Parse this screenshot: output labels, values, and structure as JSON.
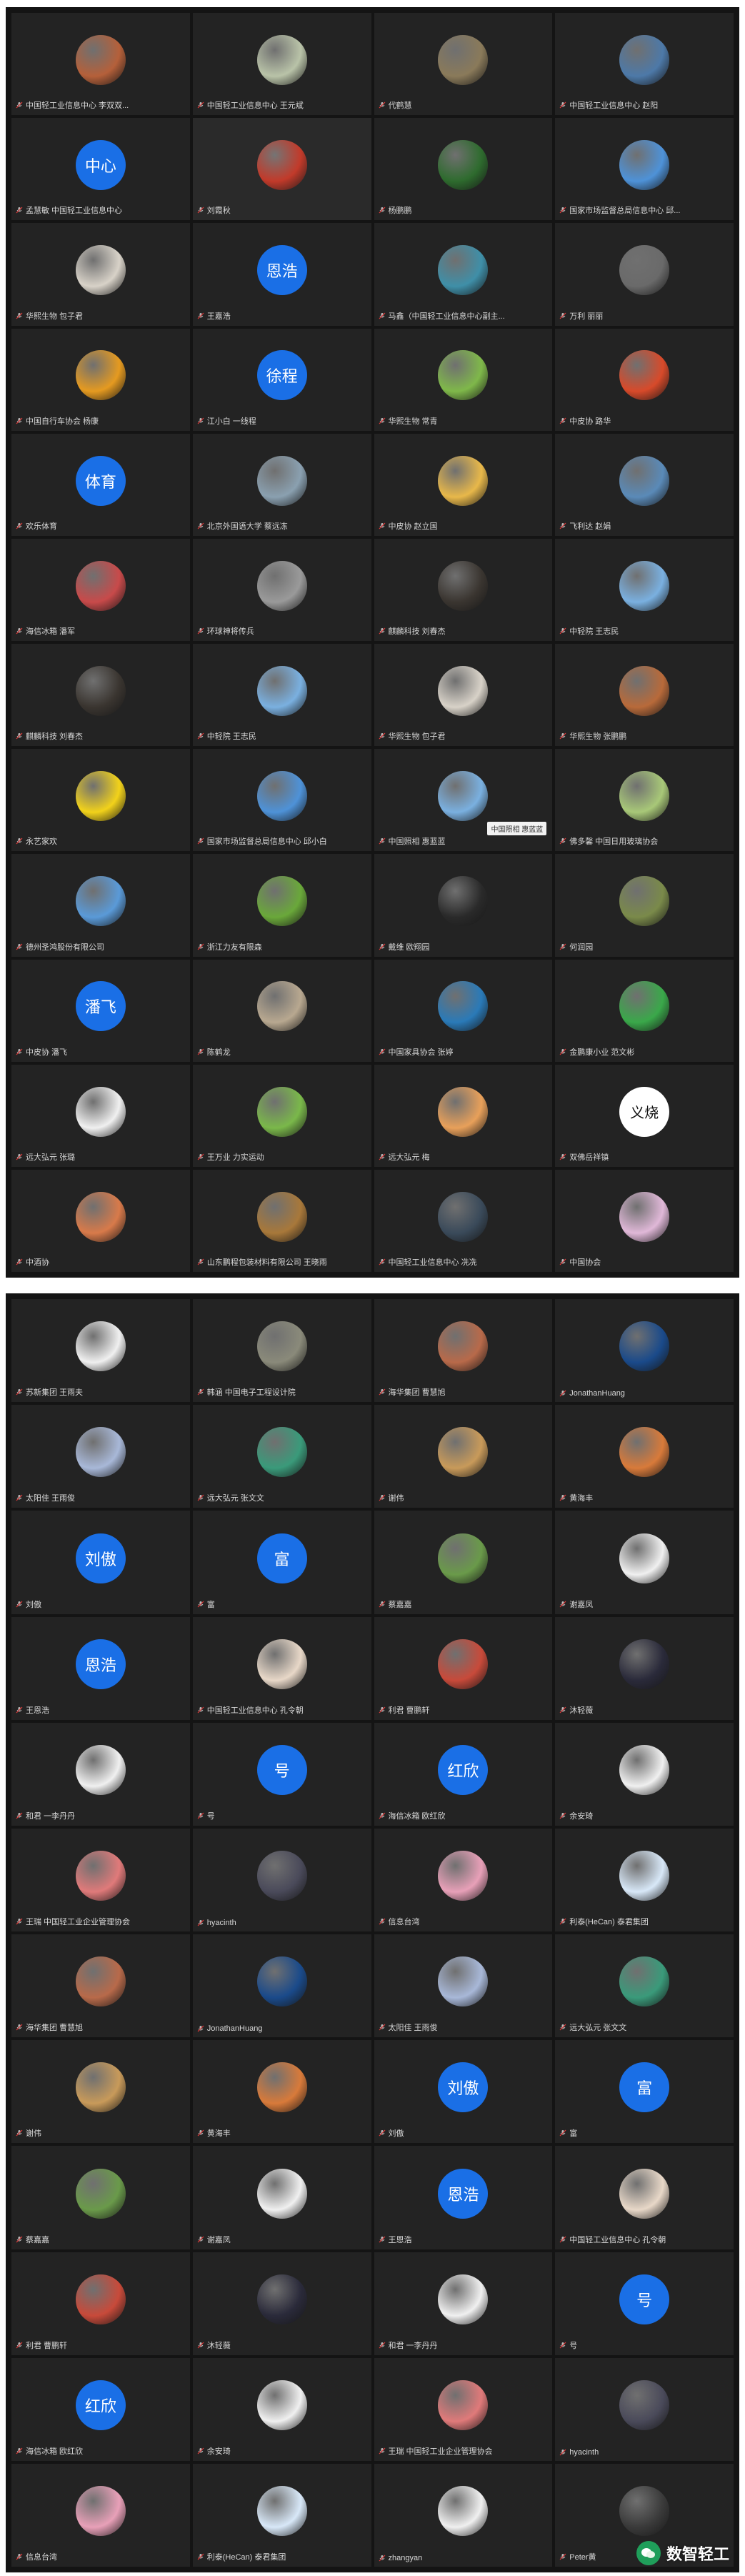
{
  "colors": {
    "tile_bg": "#232323",
    "text_avatar_bg": "#1a6fe6",
    "name_text": "#d8d8d8"
  },
  "screenshot1": {
    "participants": [
      {
        "name": "中国轻工业信息中心 李双双...",
        "avatar": {
          "kind": "photo",
          "color": "#b5603a"
        }
      },
      {
        "name": "中国轻工业信息中心 王元斌",
        "avatar": {
          "kind": "photo",
          "color": "#b9c3a8"
        }
      },
      {
        "name": "代鹤慧",
        "avatar": {
          "kind": "photo",
          "color": "#8a7a5a"
        }
      },
      {
        "name": "中国轻工业信息中心 赵阳",
        "avatar": {
          "kind": "photo",
          "color": "#4d79a8"
        }
      },
      {
        "name": "孟慧敏 中国轻工业信息中心",
        "avatar": {
          "kind": "text",
          "text": "中心"
        }
      },
      {
        "name": "刘霞秋",
        "avatar": {
          "kind": "photo",
          "color": "#c23a2a"
        },
        "highlight": true
      },
      {
        "name": "杨鹏鹏",
        "avatar": {
          "kind": "photo",
          "color": "#2e6b2e"
        }
      },
      {
        "name": "国家市场监督总局信息中心 邱...",
        "avatar": {
          "kind": "photo",
          "color": "#4e92d8"
        }
      },
      {
        "name": "华熙生物 包子君",
        "avatar": {
          "kind": "photo",
          "color": "#d8d2c8"
        }
      },
      {
        "name": "王嘉浩",
        "avatar": {
          "kind": "text",
          "text": "恩浩"
        }
      },
      {
        "name": "马鑫（中国轻工业信息中心副主...",
        "avatar": {
          "kind": "photo",
          "color": "#3f8fa8"
        }
      },
      {
        "name": "万利 丽丽",
        "avatar": {
          "kind": "photo",
          "color": "#6a6a6a"
        }
      },
      {
        "name": "中国自行车协会 杨康",
        "avatar": {
          "kind": "photo",
          "color": "#e59a20"
        }
      },
      {
        "name": "江小白 一线程",
        "avatar": {
          "kind": "text",
          "text": "徐程"
        }
      },
      {
        "name": "华熙生物 常青",
        "avatar": {
          "kind": "photo",
          "color": "#7fb84a"
        }
      },
      {
        "name": "中皮协 路华",
        "avatar": {
          "kind": "photo",
          "color": "#d84a2a"
        }
      },
      {
        "name": "欢乐体育",
        "avatar": {
          "kind": "text",
          "text": "体育"
        }
      },
      {
        "name": "北京外国语大学 蔡远冻",
        "avatar": {
          "kind": "photo",
          "color": "#8aa0b0"
        }
      },
      {
        "name": "中皮协 赵立国",
        "avatar": {
          "kind": "photo",
          "color": "#e8b84a"
        }
      },
      {
        "name": "飞利达 赵娟",
        "avatar": {
          "kind": "photo",
          "color": "#5a8ab8"
        }
      },
      {
        "name": "海信冰箱 潘军",
        "avatar": {
          "kind": "photo",
          "color": "#c84a4a"
        }
      },
      {
        "name": "环球神将传兵",
        "avatar": {
          "kind": "photo",
          "color": "#9a9a9a"
        }
      },
      {
        "name": "麒麟科技 刘春杰",
        "avatar": {
          "kind": "photo",
          "color": "#3a3530"
        }
      },
      {
        "name": "中轻院 王志民",
        "avatar": {
          "kind": "photo",
          "color": "#7ab0e0"
        }
      },
      {
        "name": "麒麟科技 刘春杰",
        "avatar": {
          "kind": "photo",
          "color": "#3a3530"
        }
      },
      {
        "name": "中轻院 王志民",
        "avatar": {
          "kind": "photo",
          "color": "#7ab0e0"
        }
      },
      {
        "name": "华熙生物 包子君",
        "avatar": {
          "kind": "photo",
          "color": "#d8d2c8"
        }
      },
      {
        "name": "华熙生物 张鹏鹏",
        "avatar": {
          "kind": "photo",
          "color": "#b86a3a"
        }
      },
      {
        "name": "永艺家欢",
        "avatar": {
          "kind": "photo",
          "color": "#f2d21a"
        }
      },
      {
        "name": "国家市场监督总局信息中心 邱小白",
        "avatar": {
          "kind": "photo",
          "color": "#4e92d8"
        }
      },
      {
        "name": "中国照相 惠蓝蓝",
        "avatar": {
          "kind": "photo",
          "color": "#7ab0e0"
        },
        "tooltip": "中国照相 惠蓝蓝"
      },
      {
        "name": "佛多馨 中国日用玻璃协会",
        "avatar": {
          "kind": "photo",
          "color": "#a8c878"
        }
      },
      {
        "name": "德州圣鸿股份有限公司",
        "avatar": {
          "kind": "photo",
          "color": "#5a9ad8"
        }
      },
      {
        "name": "浙江力友有限森",
        "avatar": {
          "kind": "photo",
          "color": "#6aa83a"
        }
      },
      {
        "name": "戴维 欧翔园",
        "avatar": {
          "kind": "photo",
          "color": "#2a2a2a"
        }
      },
      {
        "name": "何润园",
        "avatar": {
          "kind": "photo",
          "color": "#7a8a4a"
        }
      },
      {
        "name": "中皮协 潘飞",
        "avatar": {
          "kind": "text",
          "text": "潘飞"
        }
      },
      {
        "name": "陈鹤龙",
        "avatar": {
          "kind": "photo",
          "color": "#b8a890"
        }
      },
      {
        "name": "中国家具协会 张婷",
        "avatar": {
          "kind": "photo",
          "color": "#2a7ab8"
        }
      },
      {
        "name": "金鹏康小业 范文彬",
        "avatar": {
          "kind": "photo",
          "color": "#3aa84a"
        }
      },
      {
        "name": "远大弘元 张璐",
        "avatar": {
          "kind": "photo",
          "color": "#f0f0f0"
        }
      },
      {
        "name": "王万业 力实运动",
        "avatar": {
          "kind": "photo",
          "color": "#7ab84a"
        }
      },
      {
        "name": "远大弘元 梅",
        "avatar": {
          "kind": "photo",
          "color": "#e8a05a"
        }
      },
      {
        "name": "双佛岳祥镇",
        "avatar": {
          "kind": "white",
          "text": "义烧"
        }
      },
      {
        "name": "中酒协",
        "avatar": {
          "kind": "photo",
          "color": "#d87a4a"
        }
      },
      {
        "name": "山东鹏程包装材料有限公司 王晓雨",
        "avatar": {
          "kind": "photo",
          "color": "#a8783a"
        }
      },
      {
        "name": "中国轻工业信息中心 冼冼",
        "avatar": {
          "kind": "photo",
          "color": "#3a4a5a"
        }
      },
      {
        "name": "中国协会",
        "avatar": {
          "kind": "photo",
          "color": "#e0b8d8"
        }
      }
    ]
  },
  "screenshot2": {
    "participants": [
      {
        "name": "苏新集团 王雨夫",
        "avatar": {
          "kind": "photo",
          "color": "#f0f0f0"
        }
      },
      {
        "name": "韩涵 中国电子工程设计院",
        "avatar": {
          "kind": "photo",
          "color": "#8a8a7a"
        }
      },
      {
        "name": "海华集团 曹慧旭",
        "avatar": {
          "kind": "photo",
          "color": "#b86a4a"
        }
      },
      {
        "name": "JonathanHuang",
        "avatar": {
          "kind": "photo",
          "color": "#1a4a8a"
        }
      },
      {
        "name": "太阳佳 王雨俊",
        "avatar": {
          "kind": "photo",
          "color": "#a8b8d8"
        }
      },
      {
        "name": "远大弘元 张文文",
        "avatar": {
          "kind": "photo",
          "color": "#3a9a7a"
        }
      },
      {
        "name": "谢伟",
        "avatar": {
          "kind": "photo",
          "color": "#c89a5a"
        }
      },
      {
        "name": "黄海丰",
        "avatar": {
          "kind": "photo",
          "color": "#d87a3a"
        }
      },
      {
        "name": "刘傲",
        "avatar": {
          "kind": "text",
          "text": "刘傲"
        }
      },
      {
        "name": "富",
        "avatar": {
          "kind": "text",
          "text": "富"
        }
      },
      {
        "name": "蔡嘉嘉",
        "avatar": {
          "kind": "photo",
          "color": "#6a9a4a"
        }
      },
      {
        "name": "谢嘉凤",
        "avatar": {
          "kind": "photo",
          "color": "#f0f0f0"
        }
      },
      {
        "name": "王恩浩",
        "avatar": {
          "kind": "text",
          "text": "恩浩"
        }
      },
      {
        "name": "中国轻工业信息中心 孔令朝",
        "avatar": {
          "kind": "photo",
          "color": "#e8d8c8"
        }
      },
      {
        "name": "利君 曹鹏轩",
        "avatar": {
          "kind": "photo",
          "color": "#c84a3a"
        }
      },
      {
        "name": "沐轻薇",
        "avatar": {
          "kind": "photo",
          "color": "#2a2a3a"
        }
      },
      {
        "name": "和君 一李丹丹",
        "avatar": {
          "kind": "photo",
          "color": "#f0f0f0"
        }
      },
      {
        "name": "号",
        "avatar": {
          "kind": "text",
          "text": "号"
        }
      },
      {
        "name": "海信冰箱 欧红欣",
        "avatar": {
          "kind": "text",
          "text": "红欣"
        }
      },
      {
        "name": "余安琦",
        "avatar": {
          "kind": "photo",
          "color": "#f0f0f0"
        }
      },
      {
        "name": "王瑞 中国轻工业企业管理协会",
        "avatar": {
          "kind": "photo",
          "color": "#e07a7a"
        }
      },
      {
        "name": "hyacinth",
        "avatar": {
          "kind": "photo",
          "color": "#4a4a5a"
        }
      },
      {
        "name": "信息台湾",
        "avatar": {
          "kind": "photo",
          "color": "#e8a0b8"
        }
      },
      {
        "name": "利泰(HeCan) 泰君集团",
        "avatar": {
          "kind": "photo",
          "color": "#d8e8f8"
        }
      },
      {
        "name": "海华集团 曹慧旭",
        "avatar": {
          "kind": "photo",
          "color": "#b86a4a"
        }
      },
      {
        "name": "JonathanHuang",
        "avatar": {
          "kind": "photo",
          "color": "#1a4a8a"
        }
      },
      {
        "name": "太阳佳 王雨俊",
        "avatar": {
          "kind": "photo",
          "color": "#a8b8d8"
        }
      },
      {
        "name": "远大弘元 张文文",
        "avatar": {
          "kind": "photo",
          "color": "#3a9a7a"
        }
      },
      {
        "name": "谢伟",
        "avatar": {
          "kind": "photo",
          "color": "#c89a5a"
        }
      },
      {
        "name": "黄海丰",
        "avatar": {
          "kind": "photo",
          "color": "#d87a3a"
        }
      },
      {
        "name": "刘傲",
        "avatar": {
          "kind": "text",
          "text": "刘傲"
        }
      },
      {
        "name": "富",
        "avatar": {
          "kind": "text",
          "text": "富"
        }
      },
      {
        "name": "蔡嘉嘉",
        "avatar": {
          "kind": "photo",
          "color": "#6a9a4a"
        }
      },
      {
        "name": "谢嘉凤",
        "avatar": {
          "kind": "photo",
          "color": "#f0f0f0"
        }
      },
      {
        "name": "王恩浩",
        "avatar": {
          "kind": "text",
          "text": "恩浩"
        }
      },
      {
        "name": "中国轻工业信息中心 孔令朝",
        "avatar": {
          "kind": "photo",
          "color": "#e8d8c8"
        }
      },
      {
        "name": "利君 曹鹏轩",
        "avatar": {
          "kind": "photo",
          "color": "#c84a3a"
        }
      },
      {
        "name": "沐轻薇",
        "avatar": {
          "kind": "photo",
          "color": "#2a2a3a"
        }
      },
      {
        "name": "和君 一李丹丹",
        "avatar": {
          "kind": "photo",
          "color": "#f0f0f0"
        }
      },
      {
        "name": "号",
        "avatar": {
          "kind": "text",
          "text": "号"
        }
      },
      {
        "name": "海信冰箱 欧红欣",
        "avatar": {
          "kind": "text",
          "text": "红欣"
        }
      },
      {
        "name": "余安琦",
        "avatar": {
          "kind": "photo",
          "color": "#f0f0f0"
        }
      },
      {
        "name": "王瑞 中国轻工业企业管理协会",
        "avatar": {
          "kind": "photo",
          "color": "#e07a7a"
        }
      },
      {
        "name": "hyacinth",
        "avatar": {
          "kind": "photo",
          "color": "#4a4a5a"
        }
      },
      {
        "name": "信息台湾",
        "avatar": {
          "kind": "photo",
          "color": "#e8a0b8"
        }
      },
      {
        "name": "利泰(HeCan) 泰君集团",
        "avatar": {
          "kind": "photo",
          "color": "#d8e8f8"
        }
      },
      {
        "name": "zhangyan",
        "avatar": {
          "kind": "photo",
          "color": "#f0f0f0"
        }
      },
      {
        "name": "Peter黄",
        "avatar": {
          "kind": "photo",
          "color": "#3a3a3a"
        }
      }
    ]
  },
  "watermark": {
    "text": "数智轻工"
  }
}
